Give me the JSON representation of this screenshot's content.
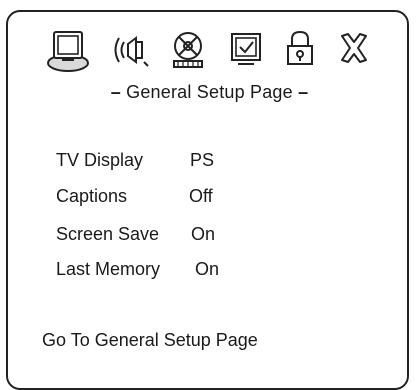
{
  "menu": {
    "icons": [
      {
        "name": "tv-display-icon",
        "selected": true
      },
      {
        "name": "audio-speaker-icon",
        "selected": false
      },
      {
        "name": "video-reel-icon",
        "selected": false
      },
      {
        "name": "preference-checkbox-icon",
        "selected": false
      },
      {
        "name": "lock-icon",
        "selected": false
      },
      {
        "name": "exit-x-icon",
        "selected": false
      }
    ],
    "highlight_color": "#d9d9d9"
  },
  "page": {
    "dash_left": "–",
    "title": "General Setup Page",
    "dash_right": "–"
  },
  "settings": [
    {
      "label": "TV Display",
      "value": "PS"
    },
    {
      "label": "Captions",
      "value": "Off"
    },
    {
      "label": "Screen Save",
      "value": "On"
    },
    {
      "label": "Last Memory",
      "value": "On"
    }
  ],
  "status": "Go To General Setup Page"
}
